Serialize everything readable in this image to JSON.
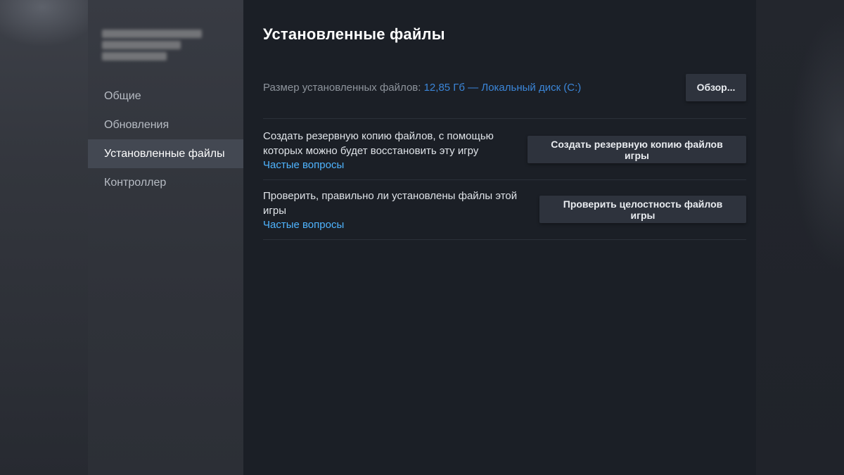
{
  "close_icon": "chevron-right-icon",
  "sidebar": {
    "items": [
      {
        "label": "Общие",
        "active": false
      },
      {
        "label": "Обновления",
        "active": false
      },
      {
        "label": "Установленные файлы",
        "active": true
      },
      {
        "label": "Контроллер",
        "active": false
      }
    ]
  },
  "main": {
    "title": "Установленные файлы",
    "size": {
      "label": "Размер установленных файлов: ",
      "value": "12,85 Гб — Локальный диск (C:)",
      "browse_label": "Обзор..."
    },
    "backup": {
      "description": "Создать резервную копию файлов, с помощью которых можно будет восстановить эту игру",
      "faq_label": "Частые вопросы",
      "button_label": "Создать резервную копию файлов игры"
    },
    "verify": {
      "description": "Проверить, правильно ли установлены файлы этой игры",
      "faq_label": "Частые вопросы",
      "button_label": "Проверить целостность файлов игры"
    }
  },
  "colors": {
    "accent_link": "#4fb4ff",
    "size_value": "#3b86d9",
    "active_nav_bg": "#434852"
  }
}
